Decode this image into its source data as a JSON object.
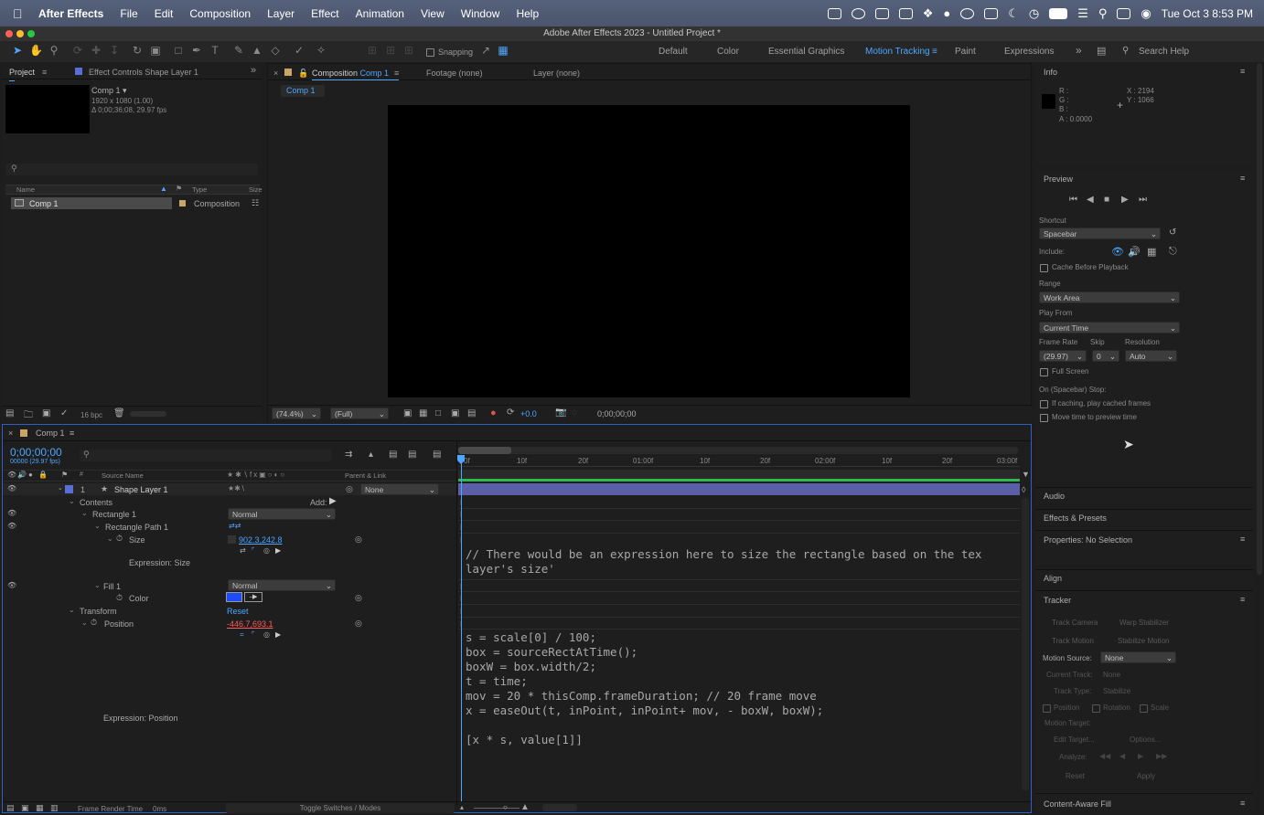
{
  "menubar": {
    "app": "After Effects",
    "items": [
      "File",
      "Edit",
      "Composition",
      "Layer",
      "Effect",
      "Animation",
      "View",
      "Window",
      "Help"
    ],
    "clock": "Tue Oct 3  8:53 PM"
  },
  "window_title": "Adobe After Effects 2023 - Untitled Project *",
  "toolbar": {
    "snapping": "Snapping",
    "workspaces": [
      "Default",
      "Color",
      "Essential Graphics",
      "Motion Tracking",
      "Paint",
      "Expressions"
    ],
    "active_workspace": "Motion Tracking",
    "search_placeholder": "Search Help"
  },
  "project": {
    "tab_project": "Project",
    "tab_effect_controls": "Effect Controls Shape Layer 1",
    "comp_name": "Comp 1 ▾",
    "comp_info1": "1920 x 1080 (1.00)",
    "comp_info2": "Δ 0;00;36;08, 29.97 fps",
    "col_name": "Name",
    "col_type": "Type",
    "col_size": "Size",
    "item_name": "Comp 1",
    "item_type": "Composition",
    "bpc": "16 bpc"
  },
  "viewer": {
    "tab_composition": "Composition",
    "tab_comp_name": "Comp 1",
    "tab_footage": "Footage (none)",
    "tab_layer": "Layer (none)",
    "breadcrumb": "Comp 1",
    "zoom": "(74.4%)",
    "resolution": "(Full)",
    "exposure": "+0.0",
    "timecode": "0;00;00;00"
  },
  "timeline": {
    "tab": "Comp 1",
    "timecode": "0;00;00;00",
    "timecode_sub": "00000 (29.97 fps)",
    "col_source": "Source Name",
    "col_parent": "Parent & Link",
    "layer_num": "1",
    "layer_name": "Shape Layer 1",
    "parent": "None",
    "contents": "Contents",
    "add": "Add:",
    "rect1": "Rectangle 1",
    "rect1_mode": "Normal",
    "rect_path": "Rectangle Path 1",
    "size": "Size",
    "size_value": "902.3,242.8",
    "expr_size": "Expression: Size",
    "fill1": "Fill 1",
    "fill1_mode": "Normal",
    "color": "Color",
    "transform": "Transform",
    "reset": "Reset",
    "position": "Position",
    "position_value": "-446.7,693.1",
    "expr_position": "Expression: Position",
    "footer_render": "Frame Render Time",
    "footer_render_val": "0ms",
    "footer_toggle": "Toggle Switches / Modes",
    "ruler": [
      "0f",
      "10f",
      "20f",
      "01:00f",
      "10f",
      "20f",
      "02:00f",
      "10f",
      "20f",
      "03:00f"
    ],
    "code_comment": "// There would be an expression here to size the rectangle based on the tex\nlayer's size'",
    "code_body": "s = scale[0] / 100;\nbox = sourceRectAtTime();\nboxW = box.width/2;\nt = time;\nmov = 20 * thisComp.frameDuration; // 20 frame move\nx = easeOut(t, inPoint, inPoint+ mov, - boxW, boxW);\n\n[x * s, value[1]]"
  },
  "info": {
    "title": "Info",
    "r": "R :",
    "g": "G :",
    "b": "B :",
    "a": "A :  0.0000",
    "x": "X : 2194",
    "y": "Y : 1066"
  },
  "preview": {
    "title": "Preview",
    "shortcut_label": "Shortcut",
    "shortcut": "Spacebar",
    "include_label": "Include:",
    "cache": "Cache Before Playback",
    "range_label": "Range",
    "range": "Work Area",
    "play_from_label": "Play From",
    "play_from": "Current Time",
    "frame_rate_label": "Frame Rate",
    "skip_label": "Skip",
    "resolution_label": "Resolution",
    "frame_rate": "(29.97)",
    "skip": "0",
    "resolution": "Auto",
    "full_screen": "Full Screen",
    "stop_label": "On (Spacebar) Stop:",
    "stop1": "If caching, play cached frames",
    "stop2": "Move time to preview time"
  },
  "side_panels": {
    "audio": "Audio",
    "effects": "Effects & Presets",
    "properties": "Properties: No Selection",
    "align": "Align",
    "tracker": "Tracker",
    "content_aware": "Content-Aware Fill"
  },
  "tracker": {
    "track_camera": "Track Camera",
    "warp": "Warp Stabilizer",
    "track_motion": "Track Motion",
    "stabilize": "Stabilize Motion",
    "motion_source_label": "Motion Source:",
    "motion_source": "None",
    "current_track_label": "Current Track:",
    "current_track": "None",
    "track_type_label": "Track Type:",
    "track_type": "Stabilize",
    "position": "Position",
    "rotation": "Rotation",
    "scale": "Scale",
    "motion_target": "Motion Target:",
    "edit_target": "Edit Target...",
    "options": "Options...",
    "analyze": "Analyze:",
    "reset": "Reset",
    "apply": "Apply"
  },
  "colors": {
    "accent": "#4ea6ff",
    "fill_color": "#1b4dff",
    "layer_bar": "#5a5fa8",
    "red_value": "#ff5a5a"
  }
}
